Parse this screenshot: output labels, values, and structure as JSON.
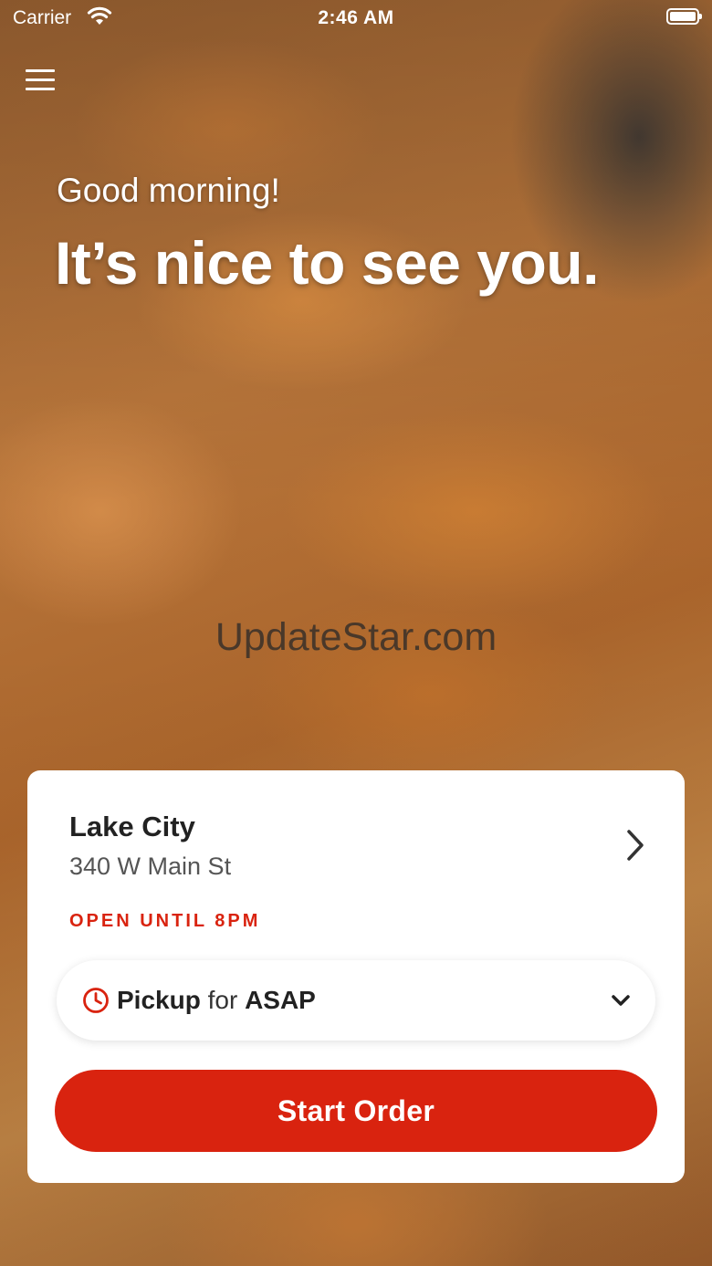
{
  "status_bar": {
    "carrier": "Carrier",
    "time": "2:46 AM"
  },
  "hero": {
    "greeting": "Good morning!",
    "headline": "It’s nice to see you.",
    "watermark": "UpdateStar.com"
  },
  "store": {
    "name": "Lake City",
    "address": "340 W Main St",
    "status": "OPEN UNTIL 8PM"
  },
  "order_mode": {
    "method": "Pickup",
    "connector": "for",
    "time": "ASAP"
  },
  "actions": {
    "start_order": "Start Order"
  },
  "colors": {
    "accent": "#d9230f",
    "card": "#ffffff",
    "text_dark": "#222222"
  },
  "icons": [
    "wifi-icon",
    "battery-icon",
    "menu-icon",
    "chevron-right-icon",
    "clock-icon",
    "chevron-down-icon"
  ]
}
